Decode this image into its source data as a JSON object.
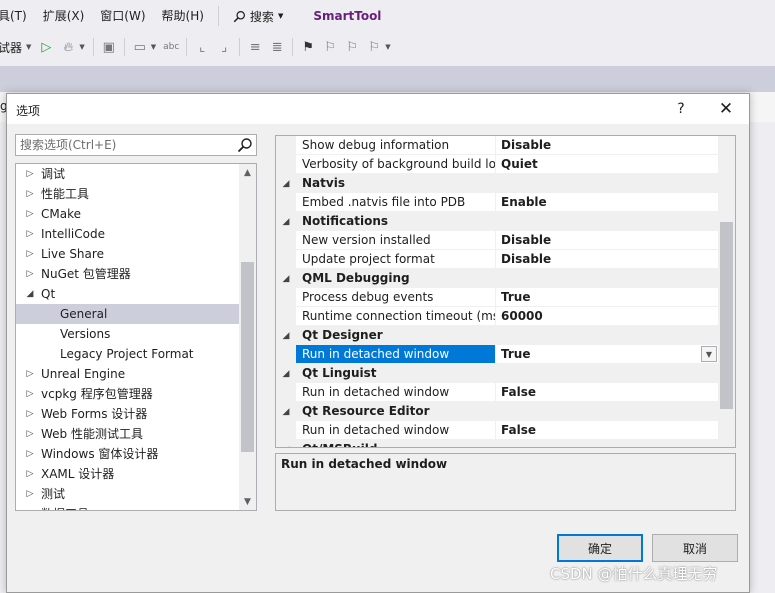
{
  "ide": {
    "menu": [
      "工具(T)",
      "扩展(X)",
      "窗口(W)",
      "帮助(H)"
    ],
    "search_label": "搜索",
    "brand": "SmartTool",
    "toolbar_debugger_label": "试器",
    "edge_text": "g"
  },
  "dialog": {
    "title": "选项",
    "help": "?",
    "close": "✕",
    "search_placeholder": "搜索选项(Ctrl+E)",
    "tree": [
      {
        "label": "调试",
        "level": 0,
        "expander": "▷"
      },
      {
        "label": "性能工具",
        "level": 0,
        "expander": "▷"
      },
      {
        "label": "CMake",
        "level": 0,
        "expander": "▷"
      },
      {
        "label": "IntelliCode",
        "level": 0,
        "expander": "▷"
      },
      {
        "label": "Live Share",
        "level": 0,
        "expander": "▷"
      },
      {
        "label": "NuGet 包管理器",
        "level": 0,
        "expander": "▷"
      },
      {
        "label": "Qt",
        "level": 0,
        "expander": "◢"
      },
      {
        "label": "General",
        "level": 1,
        "expander": "",
        "selected": true
      },
      {
        "label": "Versions",
        "level": 1,
        "expander": ""
      },
      {
        "label": "Legacy Project Format",
        "level": 1,
        "expander": ""
      },
      {
        "label": "Unreal Engine",
        "level": 0,
        "expander": "▷"
      },
      {
        "label": "vcpkg 程序包管理器",
        "level": 0,
        "expander": "▷"
      },
      {
        "label": "Web Forms 设计器",
        "level": 0,
        "expander": "▷"
      },
      {
        "label": "Web 性能测试工具",
        "level": 0,
        "expander": "▷"
      },
      {
        "label": "Windows 窗体设计器",
        "level": 0,
        "expander": "▷"
      },
      {
        "label": "XAML 设计器",
        "level": 0,
        "expander": "▷"
      },
      {
        "label": "测试",
        "level": 0,
        "expander": "▷"
      },
      {
        "label": "数据工具",
        "level": 0,
        "expander": "▷"
      }
    ],
    "properties": [
      {
        "type": "prop",
        "name": "Show debug information",
        "value": "Disable"
      },
      {
        "type": "prop",
        "name": "Verbosity of background build lo",
        "value": "Quiet"
      },
      {
        "type": "cat",
        "name": "Natvis"
      },
      {
        "type": "prop",
        "name": "Embed .natvis file into PDB",
        "value": "Enable"
      },
      {
        "type": "cat",
        "name": "Notifications"
      },
      {
        "type": "prop",
        "name": "New version installed",
        "value": "Disable"
      },
      {
        "type": "prop",
        "name": "Update project format",
        "value": "Disable"
      },
      {
        "type": "cat",
        "name": "QML Debugging"
      },
      {
        "type": "prop",
        "name": "Process debug events",
        "value": "True"
      },
      {
        "type": "prop",
        "name": "Runtime connection timeout (mse",
        "value": "60000"
      },
      {
        "type": "cat",
        "name": "Qt Designer"
      },
      {
        "type": "prop",
        "name": "Run in detached window",
        "value": "True",
        "selected": true
      },
      {
        "type": "cat",
        "name": "Qt Linguist"
      },
      {
        "type": "prop",
        "name": "Run in detached window",
        "value": "False"
      },
      {
        "type": "cat",
        "name": "Qt Resource Editor"
      },
      {
        "type": "prop",
        "name": "Run in detached window",
        "value": "False"
      },
      {
        "type": "cat",
        "name": "Qt/MSBuild"
      }
    ],
    "description_title": "Run in detached window",
    "ok_label": "确定",
    "cancel_label": "取消"
  },
  "watermark": "CSDN @怕什么真理无穷"
}
